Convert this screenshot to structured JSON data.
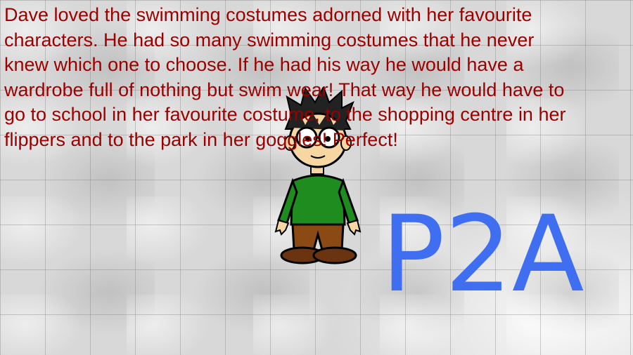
{
  "story": {
    "paragraph": "Dave loved the swimming costumes adorned with her favourite characters. He had so many swimming costumes that he never knew which one to choose. If he had his way he would have a wardrobe full of nothing but swim wear! That way he would have to go to school in her favourite costume, to the shopping centre in her flippers and to the park in her goggles! Perfect!"
  },
  "label": {
    "text": "P2A"
  },
  "colors": {
    "story_text": "#9b0000",
    "label_text": "#3f6ff0",
    "background": "#d8d8d8"
  },
  "icons": {
    "character": "cartoon-boy-icon"
  }
}
